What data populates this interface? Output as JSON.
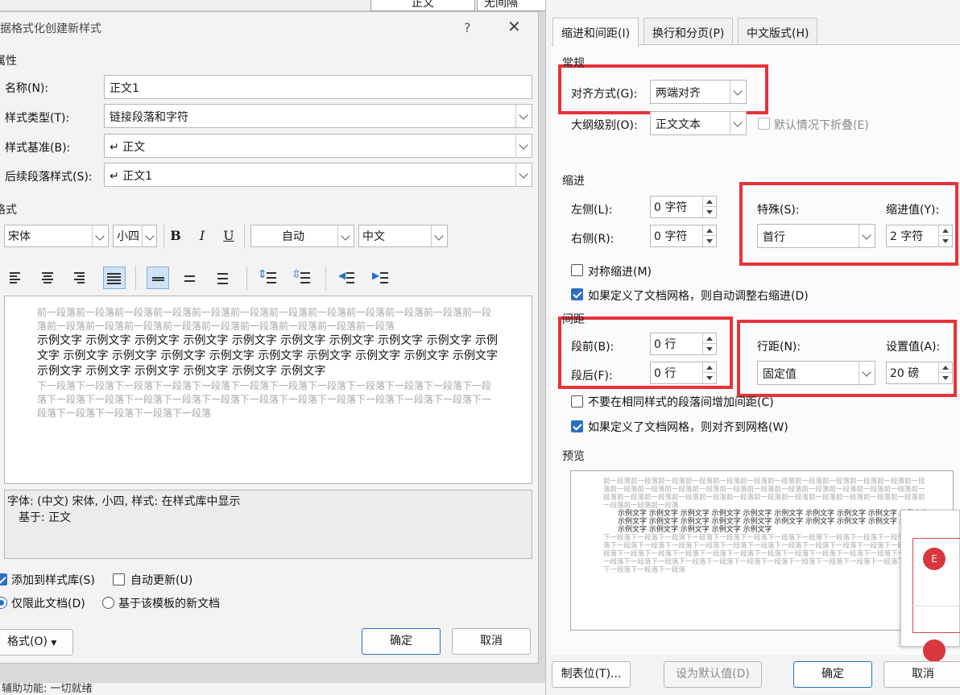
{
  "background": {
    "cells": [
      "正文",
      "无间隔"
    ],
    "status_text": "辅助功能: 一切就绪"
  },
  "left_dialog": {
    "title": "根据格式化创建新样式",
    "help": "?",
    "close": "✕",
    "section_properties": "属性",
    "name_label": "名称(N):",
    "name_value": "正文1",
    "style_type_label": "样式类型(T):",
    "style_type_value": "链接段落和字符",
    "based_on_label": "样式基准(B):",
    "based_on_value": "↵ 正文",
    "following_label": "后续段落样式(S):",
    "following_value": "↵ 正文1",
    "section_format": "格式",
    "font_value": "宋体",
    "size_value": "小四",
    "bold": "B",
    "italic": "I",
    "underline": "U",
    "color_value": "自动",
    "script_value": "中文",
    "preview_before": "前一段落前一段落前一段落前一段落前一段落前一段落前一段落前一段落前一段落前一段落前一段落前一段落前一段落前一段落前一段落前一段落前一段落前一段落前一段落前一段落前一段落",
    "preview_sample": "示例文字 示例文字 示例文字 示例文字 示例文字 示例文字 示例文字 示例文字 示例文字 示例文字 示例文字 示例文字 示例文字 示例文字 示例文字 示例文字 示例文字 示例文字 示例文字 示例文字 示例文字 示例文字 示例文字 示例文字 示例文字",
    "preview_after": "下一段落下一段落下一段落下一段落下一段落下一段落下一段落下一段落下一段落下一段落下一段落下一段落下一段落下一段落下一段落下一段落下一段落下一段落下一段落下一段落下一段落下一段落下一段落下一段落下一段落下一段落下一段落下一段落",
    "description_line1": "字体: (中文) 宋体, 小四, 样式: 在样式库中显示",
    "description_line2": "基于: 正文",
    "add_to_gallery": "添加到样式库(S)",
    "auto_update": "自动更新(U)",
    "only_this_doc": "仅限此文档(D)",
    "new_docs_template": "基于该模板的新文档",
    "format_button": "格式(O)",
    "ok": "确定",
    "cancel": "取消"
  },
  "right_dialog": {
    "tabs": [
      "缩进和间距(I)",
      "换行和分页(P)",
      "中文版式(H)"
    ],
    "section_general": "常规",
    "alignment_label": "对齐方式(G):",
    "alignment_value": "两端对齐",
    "outline_label": "大纲级别(O):",
    "outline_value": "正文文本",
    "collapse_label": "默认情况下折叠(E)",
    "section_indent": "缩进",
    "left_label": "左侧(L):",
    "left_value": "0 字符",
    "right_label": "右侧(R):",
    "right_value": "0 字符",
    "special_label": "特殊(S):",
    "special_value": "首行",
    "indent_by_label": "缩进值(Y):",
    "indent_by_value": "2 字符",
    "mirror_indent": "对称缩进(M)",
    "auto_adjust_indent": "如果定义了文档网格，则自动调整右缩进(D)",
    "section_spacing": "间距",
    "before_label": "段前(B):",
    "before_value": "0 行",
    "after_label": "段后(F):",
    "after_value": "0 行",
    "line_spacing_label": "行距(N):",
    "line_spacing_value": "固定值",
    "at_label": "设置值(A):",
    "at_value": "20 磅",
    "no_space_same_style": "不要在相同样式的段落间增加间距(C)",
    "snap_to_grid": "如果定义了文档网格，则对齐到网格(W)",
    "section_preview": "预览",
    "preview_before": "前一段落前一段落前一段落前一段落前一段落前一段落前一段落前一段落前一段落前一段落前一段落前一段落前一段落前一段落前一段落前一段落前一段落前一段落前一段落前一段落前一段落前一段落前一段落前一段落前一段落前一段落前一段落前一段落前一段落前一段落前一段落前一段落前一段落前一段落前一段落前一段落前一段落前一段落",
    "preview_sample": "示例文字 示例文字 示例文字 示例文字 示例文字 示例文字 示例文字 示例文字 示例文字 示例文字 示例文字 示例文字 示例文字 示例文字 示例文字 示例文字 示例文字 示例文字 示例文字 示例文字 示例文字 示例文字 示例文字 示例文字 示例文字",
    "preview_after": "下一段落下一段落下一段落下一段落下一段落下一段落下一段落下一段落下一段落下一段落下一段落下一段落下一段落下一段落下一段落下一段落下一段落下一段落下一段落下一段落下一段落下一段落下一段落下一段落下一段落下一段落下一段落下一段落下一段落下一段落下一段落下一段落下一段落下一段落下一段落下一段落下一段落下一段落下一段落下一段落下一段落下一段落下一段落下一段落下一段落下一段落下一段落下一段落下一段落下一段落",
    "tabs_button": "制表位(T)...",
    "set_default": "设为默认值(D)",
    "ok": "确定",
    "cancel": "取消"
  },
  "notification": {
    "avatar_letter": "E",
    "accent_color": "#d9363e"
  },
  "colors": {
    "highlight": "#e8323a",
    "accent": "#2b6fc4"
  }
}
